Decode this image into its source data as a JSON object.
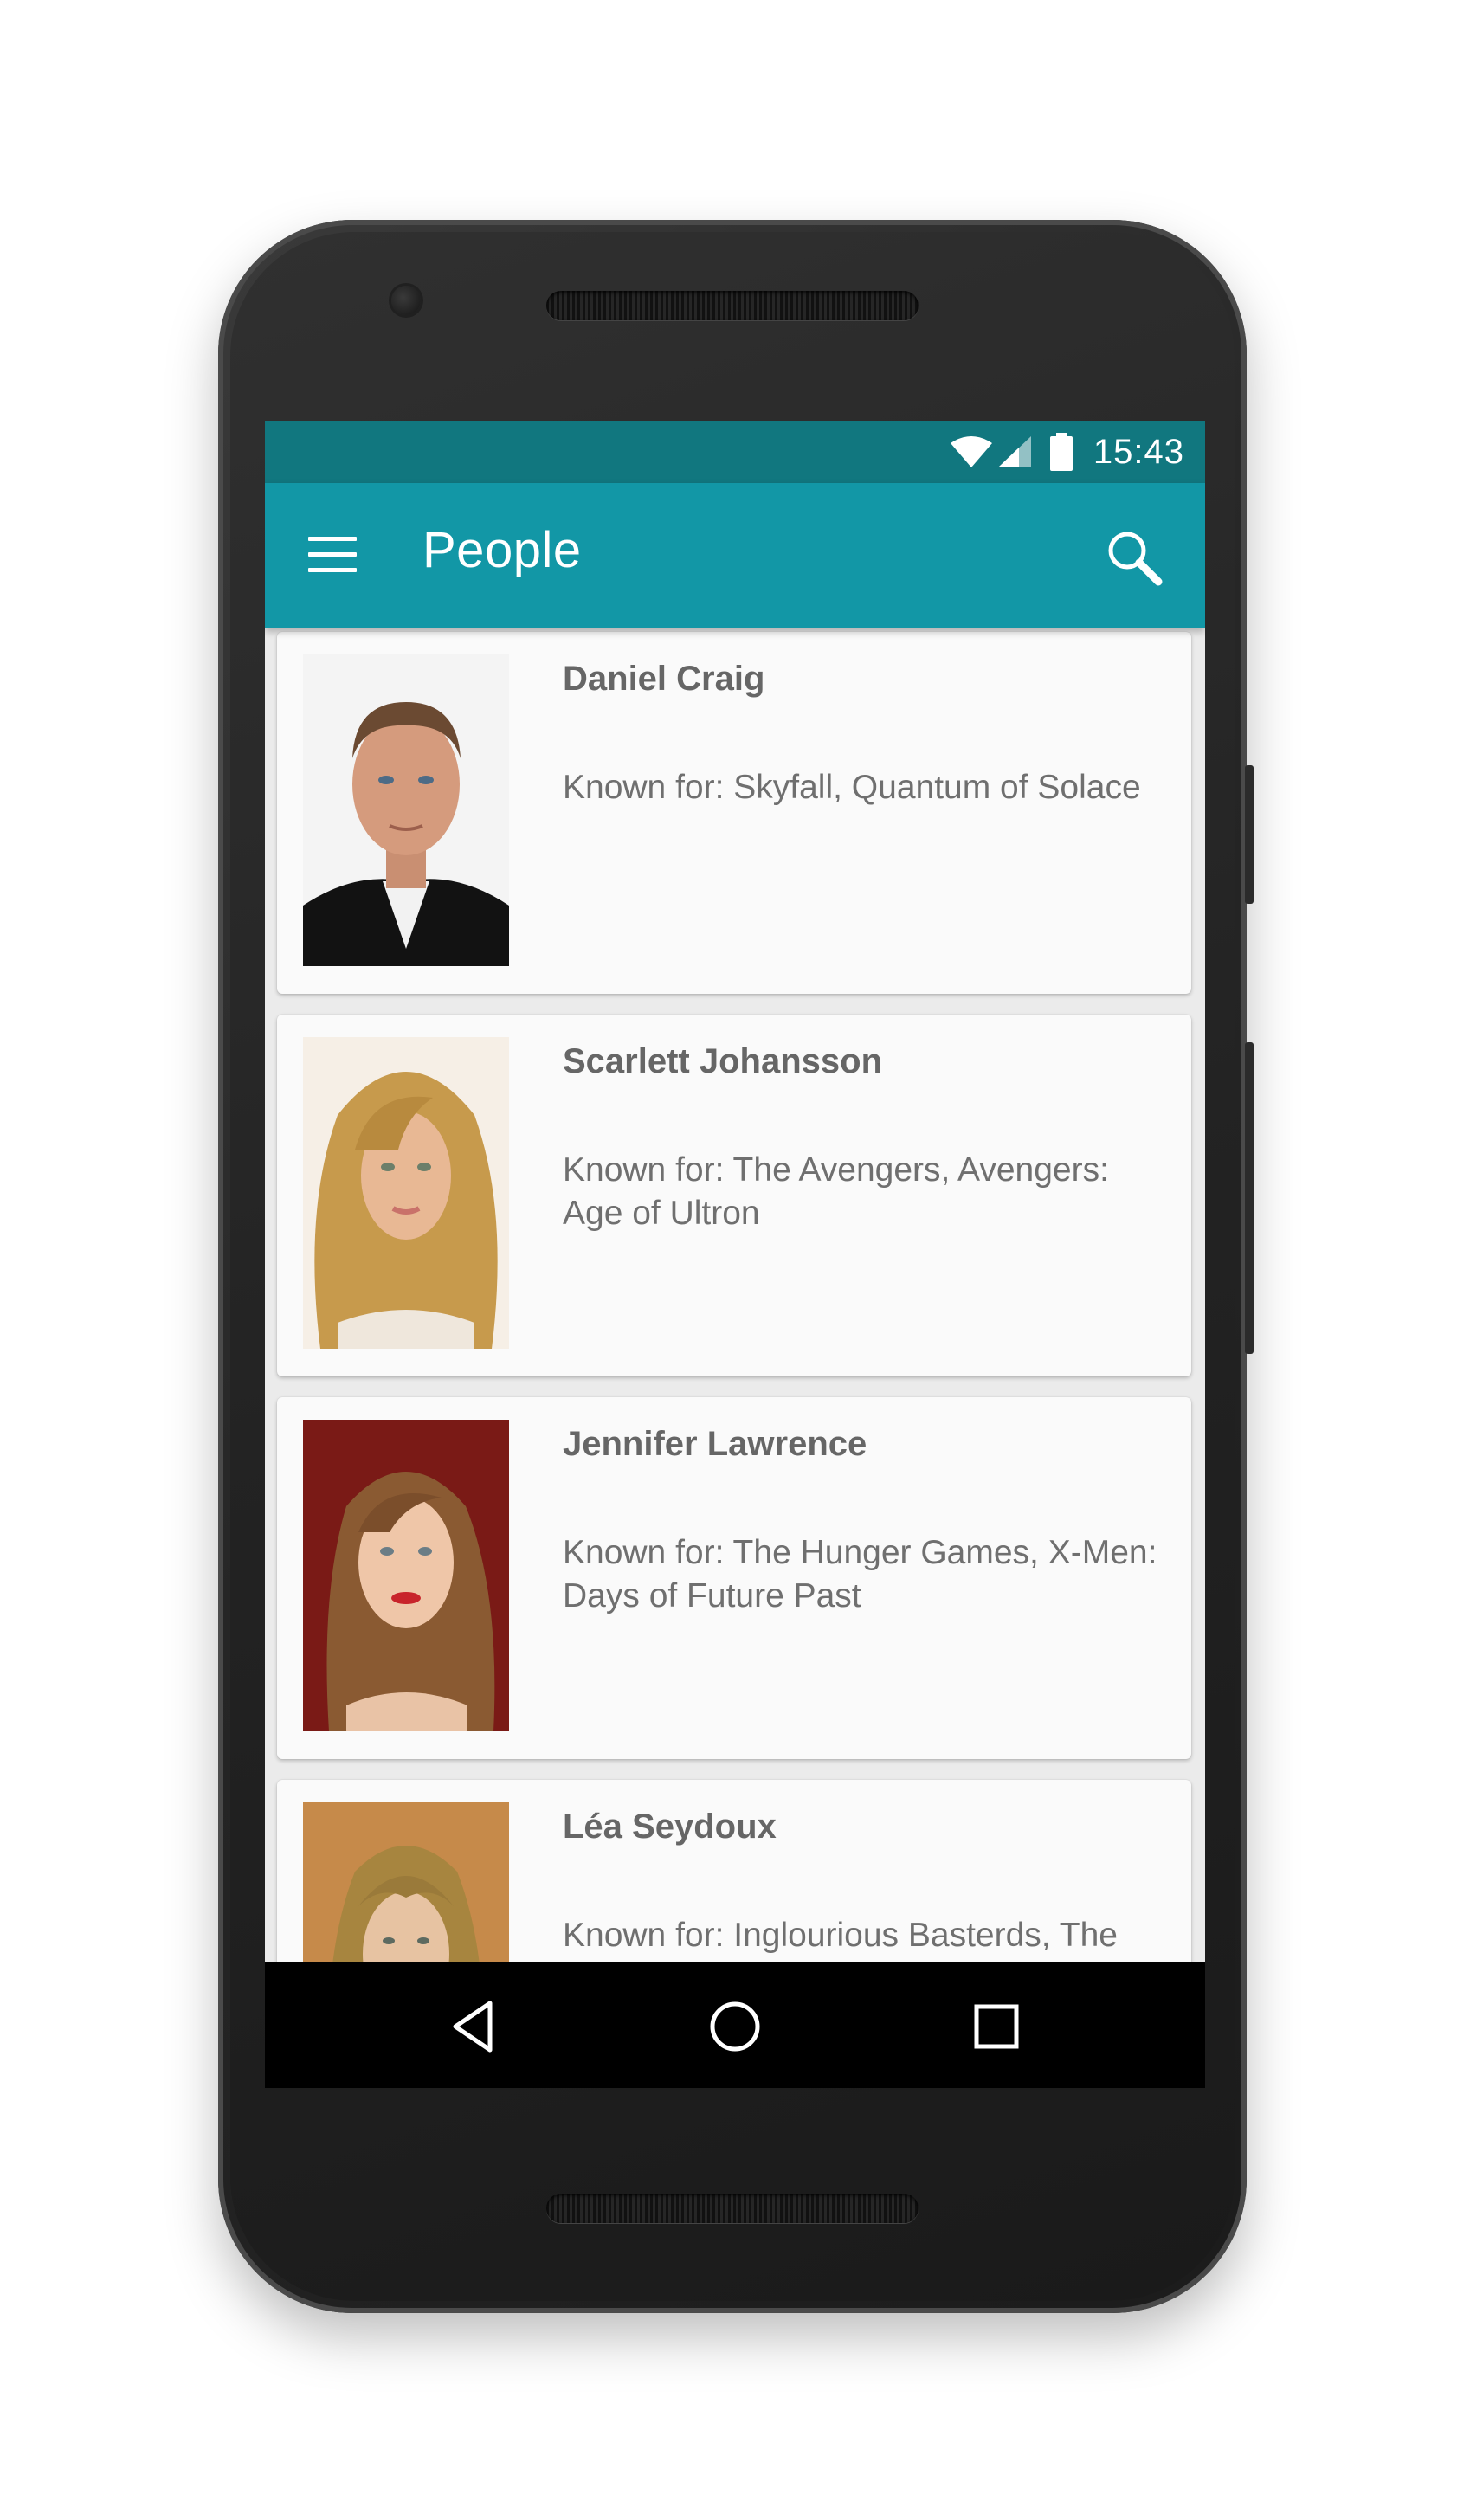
{
  "status_bar": {
    "time": "15:43",
    "icons": [
      "wifi-icon",
      "cell-signal-icon",
      "battery-icon"
    ]
  },
  "app_bar": {
    "title": "People",
    "menu_icon": "hamburger-menu-icon",
    "search_icon": "search-icon",
    "color": "#1297a6",
    "status_color": "#11777f"
  },
  "people": [
    {
      "name": "Daniel Craig",
      "known_for": "Known for: Skyfall, Quantum of Solace"
    },
    {
      "name": "Scarlett Johansson",
      "known_for": "Known for: The Avengers, Avengers: Age of Ultron"
    },
    {
      "name": "Jennifer Lawrence",
      "known_for": "Known for: The Hunger Games, X-Men: Days of Future Past"
    },
    {
      "name": "Léa Seydoux",
      "known_for": "Known for: Inglourious Basterds, The"
    }
  ],
  "nav_bar": {
    "buttons": [
      "back-icon",
      "home-icon",
      "recents-icon"
    ]
  }
}
